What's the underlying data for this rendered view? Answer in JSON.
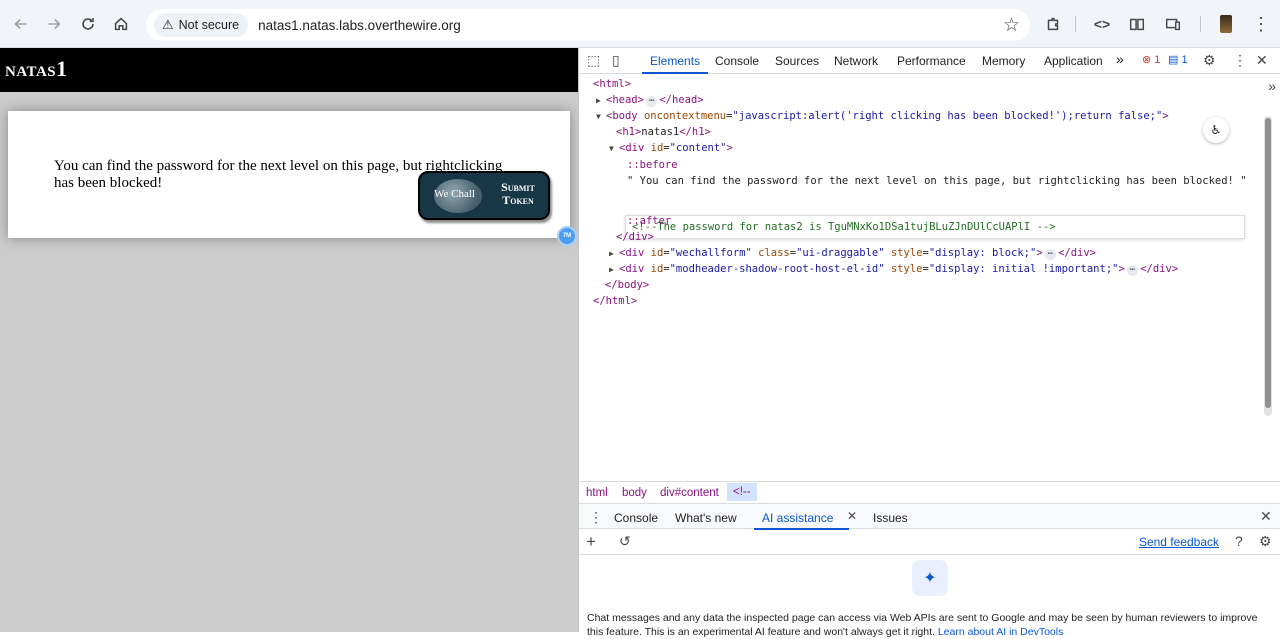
{
  "browser": {
    "security_label": "Not secure",
    "url": "natas1.natas.labs.overthewire.org"
  },
  "page": {
    "title": "natas1",
    "content_text": "You can find the password for the next level on this page, but rightclicking has been blocked!",
    "wechall": {
      "logo_text": "We Chall",
      "submit_line1": "Submit",
      "submit_line2": "Token"
    },
    "extension_badge": "7M"
  },
  "devtools": {
    "tabs": [
      "Elements",
      "Console",
      "Sources",
      "Network",
      "Performance",
      "Memory",
      "Application"
    ],
    "active_tab": "Elements",
    "more_tabs": "»",
    "error_count": "1",
    "message_count": "1",
    "dom": {
      "html_open": "<html>",
      "head": "<head>",
      "head_close": "</head>",
      "body_open_tag": "<body",
      "body_attr": "oncontextmenu",
      "body_val": "\"javascript:alert('right clicking has been blocked!');return false;\"",
      "body_gt": ">",
      "h1": "<h1>",
      "h1_text": "natas1",
      "h1_close": "</h1>",
      "div_open": "<div",
      "id_attr": "id",
      "content_val": "\"content\"",
      "before": "::before",
      "text_node": "\" You can find the password for the next level on this page, but rightclicking has been blocked! \"",
      "comment": "<!--The password for natas2 is TguMNxKo1DSa1tujBLuZJnDUlCcUAPlI -->",
      "after": "::after",
      "div_close": "</div>",
      "wechall_val": "\"wechallform\"",
      "class_attr": "class",
      "class_val": "\"ui-draggable\"",
      "style_attr": "style",
      "style_val1": "\"display: block;\"",
      "modheader_val": "\"modheader-shadow-root-host-el-id\"",
      "style_val2": "\"display: initial !important;\"",
      "body_close": "</body>",
      "html_close": "</html>",
      "ellipsis": "⋯"
    },
    "breadcrumbs": [
      "html",
      "body",
      "div#content",
      "<!--"
    ],
    "drawer_tabs": [
      "Console",
      "What's new",
      "AI assistance",
      "Issues"
    ],
    "send_feedback": "Send feedback",
    "disclaimer": "Chat messages and any data the inspected page can access via Web APIs are sent to Google and may be seen by human reviewers to improve this feature. This is an experimental AI feature and won't always get it right.",
    "learn_more": "Learn about AI in DevTools"
  },
  "colors": {
    "devtools_accent": "#0b57d0",
    "tag_color": "#881280",
    "comment_color": "#236e25",
    "page_background": "#cccccc"
  }
}
